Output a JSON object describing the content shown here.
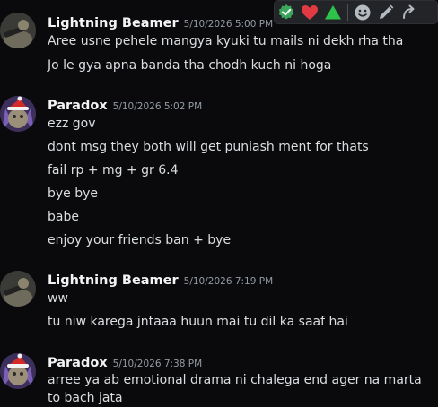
{
  "toolbar": {
    "reactions": [
      {
        "icon": "green-checkmark-icon",
        "color": "#3ba55c"
      },
      {
        "icon": "red-heart-icon",
        "color": "#e03a43"
      },
      {
        "icon": "green-triangle-icon",
        "color": "#2ec24a"
      }
    ],
    "actions": [
      "add-reaction-icon",
      "edit-icon",
      "reply-icon"
    ]
  },
  "messages": [
    {
      "username": "Lightning Beamer",
      "timestamp": "5/10/2026 5:00 PM",
      "lines": [
        "Aree usne pehele mangya kyuki tu mails ni dekh rha tha",
        "Jo le gya apna banda tha chodh kuch ni hoga"
      ]
    },
    {
      "username": "Paradox",
      "timestamp": "5/10/2026 5:02 PM",
      "lines": [
        "ezz gov",
        "dont msg they both will get puniash ment for thats",
        "fail rp + mg + gr 6.4",
        "bye bye",
        "babe",
        "enjoy your friends ban + bye"
      ]
    },
    {
      "username": "Lightning Beamer",
      "timestamp": "5/10/2026 7:19 PM",
      "lines": [
        "ww",
        "tu niw karega jntaaa huun mai tu dil ka saaf hai"
      ]
    },
    {
      "username": "Paradox",
      "timestamp": "5/10/2026 7:38 PM",
      "lines": [
        "arree ya ab emotional drama ni chalega end ager na marta to bach jata"
      ]
    }
  ]
}
